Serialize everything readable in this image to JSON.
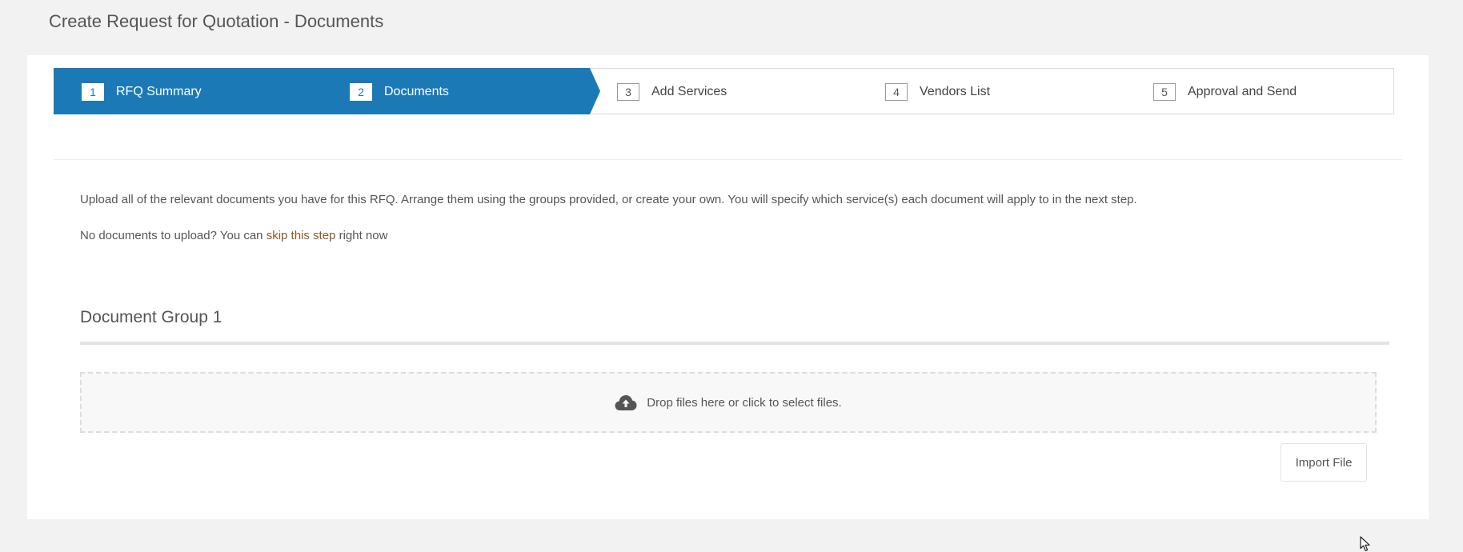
{
  "page": {
    "title": "Create Request for Quotation - Documents"
  },
  "wizard": {
    "active_color": "#1b7ab6",
    "steps": [
      {
        "number": "1",
        "label": "RFQ Summary",
        "state": "complete"
      },
      {
        "number": "2",
        "label": "Documents",
        "state": "current"
      },
      {
        "number": "3",
        "label": "Add Services",
        "state": "upcoming"
      },
      {
        "number": "4",
        "label": "Vendors List",
        "state": "upcoming"
      },
      {
        "number": "5",
        "label": "Approval and Send",
        "state": "upcoming"
      }
    ]
  },
  "intro": {
    "text": "Upload all of the relevant documents you have for this RFQ. Arrange them using the groups provided, or create your own. You will specify which service(s) each document will apply to in the next step.",
    "skip_prefix": "No documents to upload? You can",
    "skip_link": "skip this step",
    "skip_suffix": "right now",
    "link_color": "#8a5a2b"
  },
  "document_group": {
    "title": "Document Group 1",
    "dropzone_icon": "cloud-upload-icon",
    "dropzone_text": "Drop files here or click to select files.",
    "import_button": "Import File"
  },
  "cursor": {
    "icon": "mouse-pointer-icon"
  }
}
